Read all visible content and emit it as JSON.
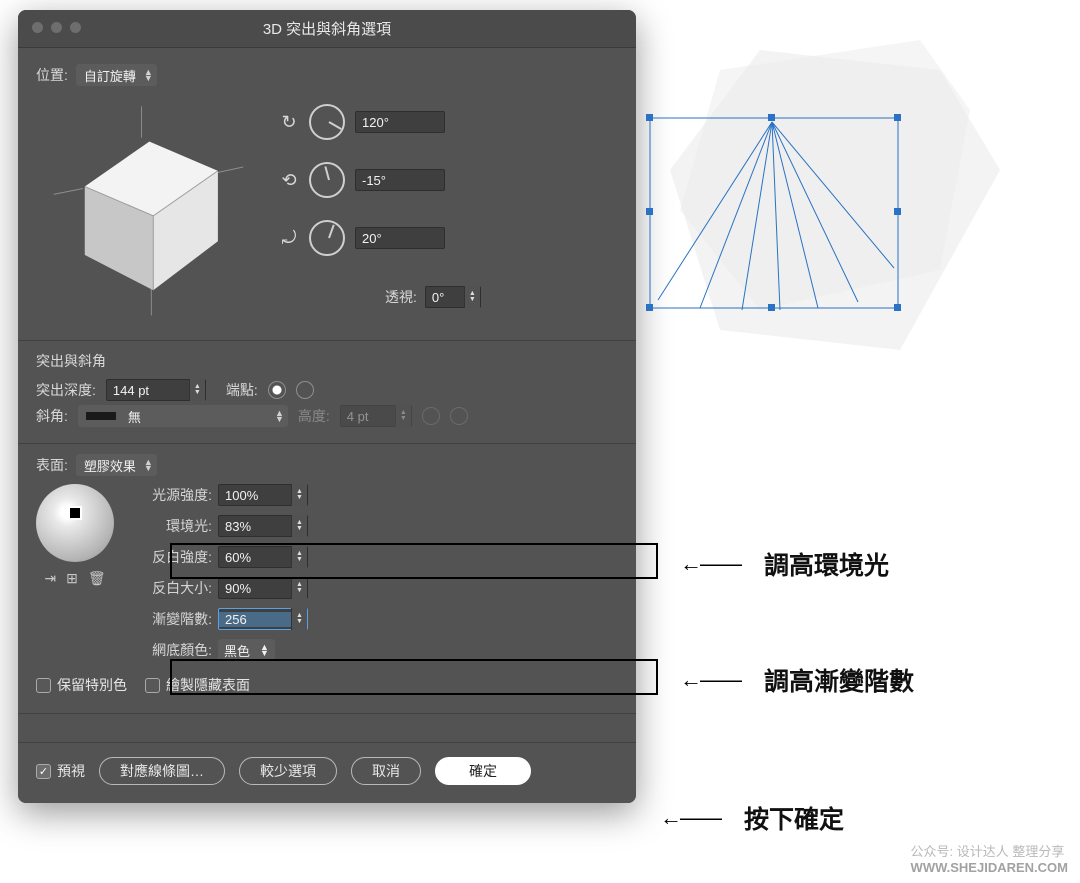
{
  "dialog": {
    "title": "3D 突出與斜角選項",
    "position_label": "位置:",
    "position_value": "自訂旋轉",
    "rot_x": "120°",
    "rot_y": "-15°",
    "rot_z": "20°",
    "perspective_label": "透視:",
    "perspective_value": "0°"
  },
  "extrude": {
    "section": "突出與斜角",
    "depth_label": "突出深度:",
    "depth_value": "144 pt",
    "cap_label": "端點:",
    "bevel_label": "斜角:",
    "bevel_value": "無",
    "height_label": "高度:",
    "height_value": "4 pt"
  },
  "surface": {
    "label": "表面:",
    "value": "塑膠效果",
    "light_intensity_label": "光源強度:",
    "light_intensity": "100%",
    "ambient_label": "環境光:",
    "ambient": "83%",
    "highlight_intensity_label": "反白強度:",
    "highlight_intensity": "60%",
    "highlight_size_label": "反白大小:",
    "highlight_size": "90%",
    "blend_steps_label": "漸變階數:",
    "blend_steps": "256",
    "shading_color_label": "網底顏色:",
    "shading_color": "黑色",
    "preserve_spot": "保留特別色",
    "draw_hidden": "繪製隱藏表面"
  },
  "footer": {
    "preview": "預視",
    "map_art": "對應線條圖…",
    "fewer": "較少選項",
    "cancel": "取消",
    "ok": "確定"
  },
  "annotations": {
    "a1": "調高環境光",
    "a2": "調高漸變階數",
    "a3": "按下確定"
  },
  "watermark": {
    "l1": "公众号: 设计达人 整理分享",
    "l2": "WWW.SHEJIDAREN.COM"
  }
}
